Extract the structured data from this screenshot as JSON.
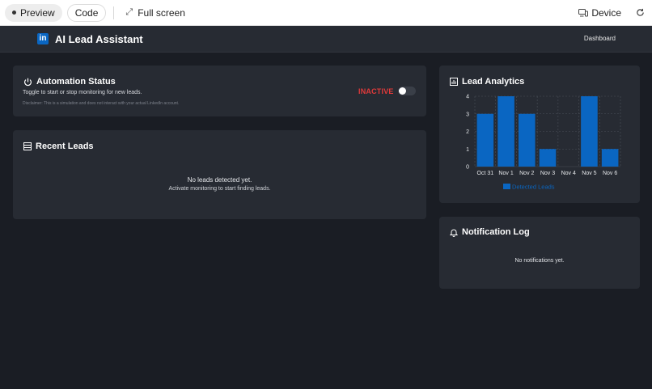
{
  "toolbar": {
    "preview_label": "Preview",
    "code_label": "Code",
    "fullscreen_label": "Full screen",
    "device_label": "Device"
  },
  "header": {
    "logo_text": "in",
    "title": "AI Lead Assistant",
    "nav_dashboard": "Dashboard"
  },
  "automation": {
    "title": "Automation Status",
    "subtitle": "Toggle to start or stop monitoring for new leads.",
    "disclaimer": "Disclaimer: This is a simulation and does not interact with your actual LinkedIn account.",
    "status": "INACTIVE",
    "enabled": false,
    "status_color": "#e23a3a"
  },
  "recent_leads": {
    "title": "Recent Leads",
    "empty_title": "No leads detected yet.",
    "empty_hint": "Activate monitoring to start finding leads."
  },
  "analytics": {
    "title": "Lead Analytics"
  },
  "notifications": {
    "title": "Notification Log",
    "empty": "No notifications yet."
  },
  "chart_data": {
    "type": "bar",
    "categories": [
      "Oct 31",
      "Nov 1",
      "Nov 2",
      "Nov 3",
      "Nov 4",
      "Nov 5",
      "Nov 6"
    ],
    "series": [
      {
        "name": "Detected Leads",
        "values": [
          3,
          4,
          3,
          1,
          0,
          4,
          1
        ],
        "color": "#0a66c2"
      }
    ],
    "ylim": [
      0,
      4
    ],
    "yticks": [
      0,
      1,
      2,
      3,
      4
    ],
    "grid": true,
    "legend": "bottom"
  },
  "colors": {
    "background": "#1a1d24",
    "card": "#272b33",
    "accent": "#0a66c2"
  }
}
